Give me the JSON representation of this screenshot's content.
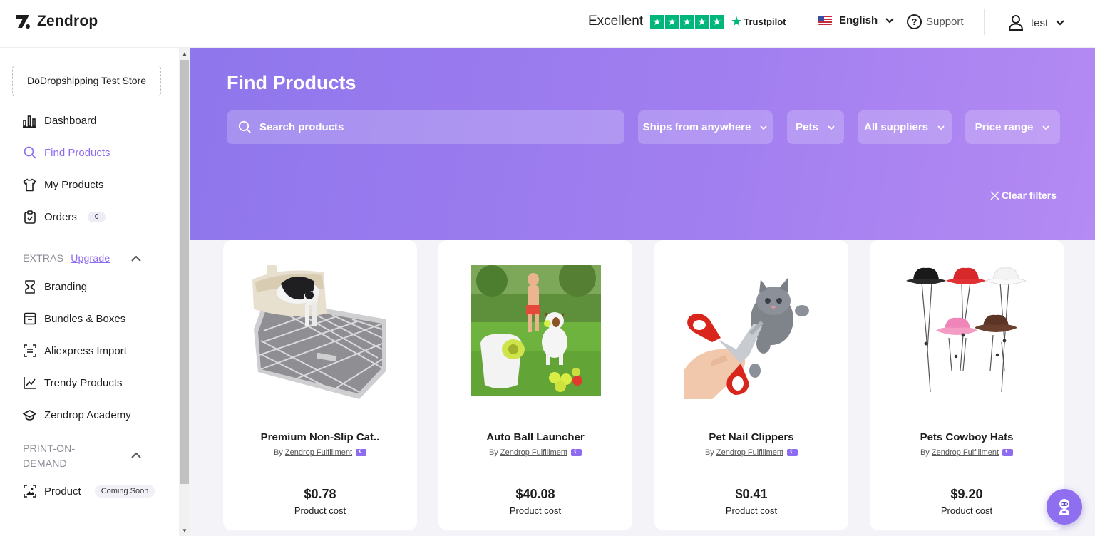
{
  "header": {
    "logo_text": "Zendrop",
    "trust_label": "Excellent",
    "trustpilot_label": "Trustpilot",
    "language": "English",
    "support_label": "Support",
    "user_name": "test"
  },
  "sidebar": {
    "store_name": "DoDropshipping Test Store",
    "main_items": [
      {
        "label": "Dashboard",
        "icon": "bar-chart-icon"
      },
      {
        "label": "Find Products",
        "icon": "search-icon",
        "active": true
      },
      {
        "label": "My Products",
        "icon": "tshirt-icon"
      },
      {
        "label": "Orders",
        "icon": "clipboard-icon",
        "badge": "0"
      }
    ],
    "extras": {
      "label": "EXTRAS",
      "upgrade_label": "Upgrade",
      "items": [
        {
          "label": "Branding",
          "icon": "branding-icon"
        },
        {
          "label": "Bundles & Boxes",
          "icon": "box-icon"
        },
        {
          "label": "Aliexpress Import",
          "icon": "scan-icon"
        },
        {
          "label": "Trendy Products",
          "icon": "trend-line-icon"
        },
        {
          "label": "Zendrop Academy",
          "icon": "graduation-cap-icon"
        }
      ]
    },
    "pod": {
      "label_line1": "PRINT-ON-",
      "label_line2": "DEMAND",
      "items": [
        {
          "label": "Product",
          "icon": "image-frame-icon",
          "badge": "Coming Soon"
        }
      ]
    }
  },
  "banner": {
    "title": "Find Products",
    "search_placeholder": "Search products",
    "filters": [
      "Ships from anywhere",
      "Pets",
      "All suppliers",
      "Price range"
    ],
    "clear_filters": "Clear filters"
  },
  "products": [
    {
      "name": "Premium Non-Slip Cat..",
      "by": "By",
      "supplier": "Zendrop Fulfillment",
      "price": "$0.78",
      "cost_label": "Product cost"
    },
    {
      "name": "Auto Ball Launcher",
      "by": "By",
      "supplier": "Zendrop Fulfillment",
      "price": "$40.08",
      "cost_label": "Product cost"
    },
    {
      "name": "Pet Nail Clippers",
      "by": "By",
      "supplier": "Zendrop Fulfillment",
      "price": "$0.41",
      "cost_label": "Product cost"
    },
    {
      "name": "Pets Cowboy Hats",
      "by": "By",
      "supplier": "Zendrop Fulfillment",
      "price": "$9.20",
      "cost_label": "Product cost"
    }
  ],
  "colors": {
    "accent": "#8d6cf0",
    "trustpilot_green": "#00b67a",
    "banner_start": "#8f76ec",
    "banner_end": "#b48af3"
  }
}
